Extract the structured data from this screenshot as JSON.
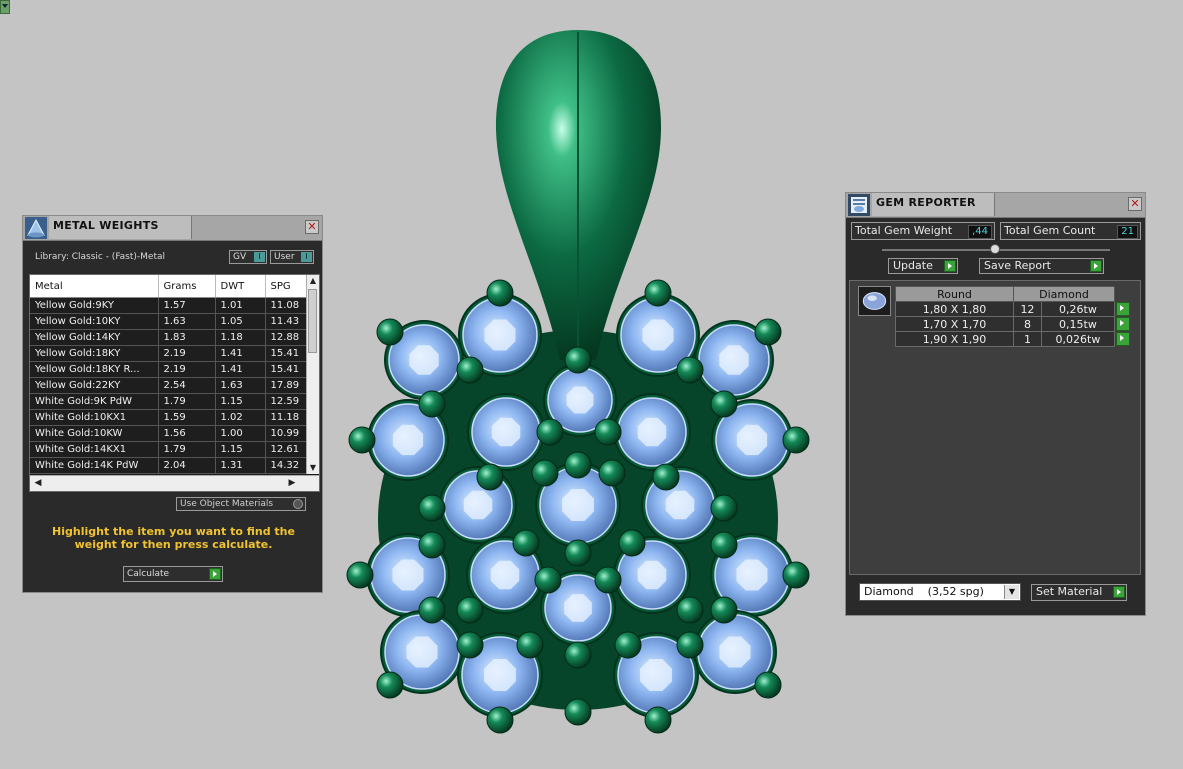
{
  "metal_weights": {
    "title": "METAL WEIGHTS",
    "library_label": "Library: Classic - (Fast)-Metal",
    "toggle_gv": "GV",
    "toggle_user": "User",
    "columns": [
      "Metal",
      "Grams",
      "DWT",
      "SPG"
    ],
    "rows": [
      [
        "Yellow Gold:9KY",
        "1.57",
        "1.01",
        "11.08"
      ],
      [
        "Yellow Gold:10KY",
        "1.63",
        "1.05",
        "11.43"
      ],
      [
        "Yellow Gold:14KY",
        "1.83",
        "1.18",
        "12.88"
      ],
      [
        "Yellow Gold:18KY",
        "2.19",
        "1.41",
        "15.41"
      ],
      [
        "Yellow Gold:18KY R...",
        "2.19",
        "1.41",
        "15.41"
      ],
      [
        "Yellow Gold:22KY",
        "2.54",
        "1.63",
        "17.89"
      ],
      [
        "White Gold:9K PdW",
        "1.79",
        "1.15",
        "12.59"
      ],
      [
        "White Gold:10KX1",
        "1.59",
        "1.02",
        "11.18"
      ],
      [
        "White Gold:10KW",
        "1.56",
        "1.00",
        "10.99"
      ],
      [
        "White Gold:14KX1",
        "1.79",
        "1.15",
        "12.61"
      ],
      [
        "White Gold:14K PdW",
        "2.04",
        "1.31",
        "14.32"
      ]
    ],
    "use_object_materials": "Use Object Materials",
    "hint": "Highlight the item you want to find the weight for then press calculate.",
    "calculate": "Calculate"
  },
  "gem_reporter": {
    "title": "GEM REPORTER",
    "total_weight_label": "Total Gem Weight",
    "total_weight_value": ",44",
    "total_count_label": "Total Gem Count",
    "total_count_value": "21",
    "update": "Update",
    "save_report": "Save Report",
    "shape_header": "Round",
    "material_header": "Diamond",
    "rows": [
      {
        "size": "1,80 X 1,80",
        "count": "12",
        "weight": "0,26tw"
      },
      {
        "size": "1,70 X 1,70",
        "count": "8",
        "weight": "0,15tw"
      },
      {
        "size": "1,90 X 1,90",
        "count": "1",
        "weight": "0,026tw"
      }
    ],
    "material_select": "Diamond    (3,52 spg)",
    "set_material": "Set Material"
  },
  "colors": {
    "metal": "#0d6b45",
    "gem": "#8fb8f2",
    "background": "#c4c4c4",
    "hint_text": "#f1c232",
    "go_button": "#3aa43a"
  }
}
